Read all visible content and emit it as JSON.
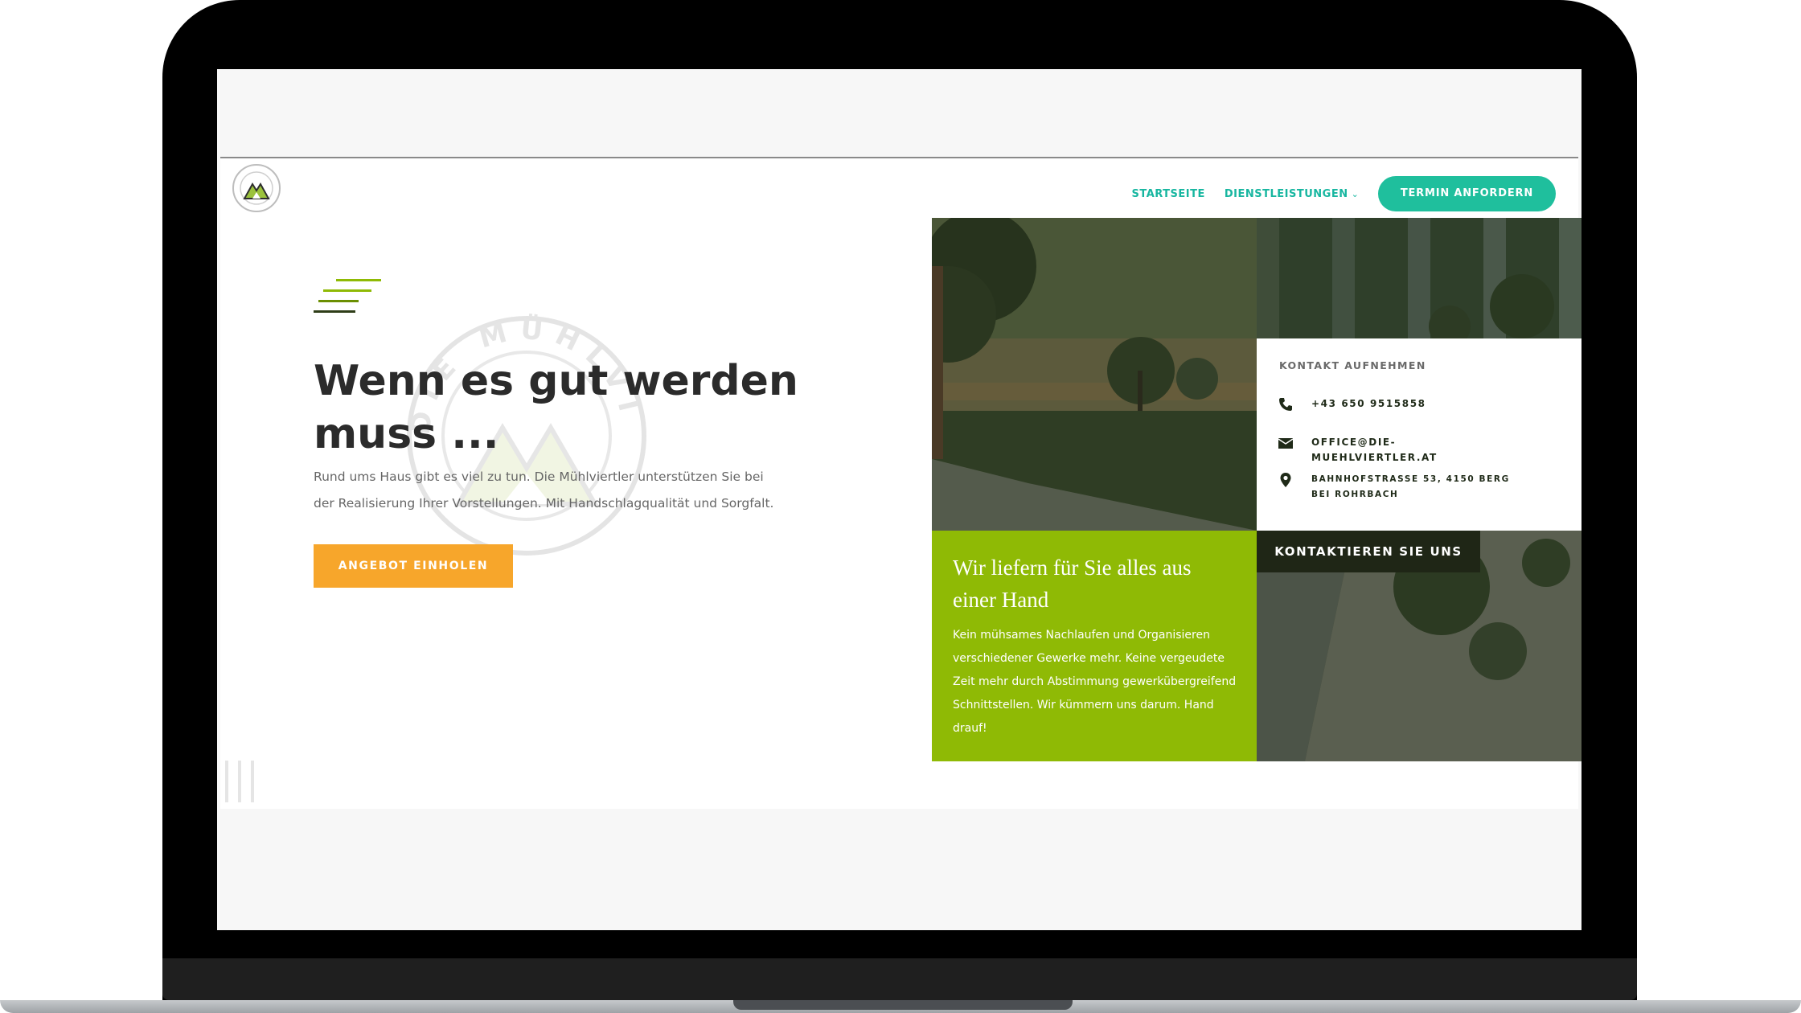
{
  "nav": {
    "items": [
      {
        "label": "STARTSEITE"
      },
      {
        "label": "DIENSTLEISTUNGEN"
      }
    ],
    "cta": "TERMIN ANFORDERN"
  },
  "hero": {
    "headline": "Wenn es gut werden muss ...",
    "text": "Rund ums Haus gibt es viel zu tun. Die Mühlviertler unterstützen Sie bei der Realisierung Ihrer Vorstellungen. Mit Handschlagqualität und Sorgfalt.",
    "button": "ANGEBOT EINHOLEN",
    "watermark_text": "DIE MÜHLVIERTLER"
  },
  "contact": {
    "title": "KONTAKT AUFNEHMEN",
    "phone": "+43 650 9515858",
    "email": "OFFICE@DIE-MUEHLVIERTLER.AT",
    "address": "BAHNHOFSTRASSE 53, 4150 BERG BEI ROHRBACH",
    "button": "KONTAKTIEREN SIE UNS"
  },
  "feature": {
    "title": "Wir liefern für Sie alles aus einer Hand",
    "text": "Kein mühsames Nachlaufen und Organisieren verschiedener Gewerke mehr. Keine vergeudete Zeit mehr durch Abstimmung gewerkübergreifend Schnittstellen. Wir kümmern uns darum. Hand drauf!"
  },
  "colors": {
    "teal": "#1fbf9d",
    "orange": "#f7a62b",
    "green": "#8fba05",
    "dark": "#1f2616"
  },
  "icons": [
    "phone-icon",
    "email-icon",
    "location-icon",
    "chevron-down-icon",
    "logo-icon"
  ]
}
